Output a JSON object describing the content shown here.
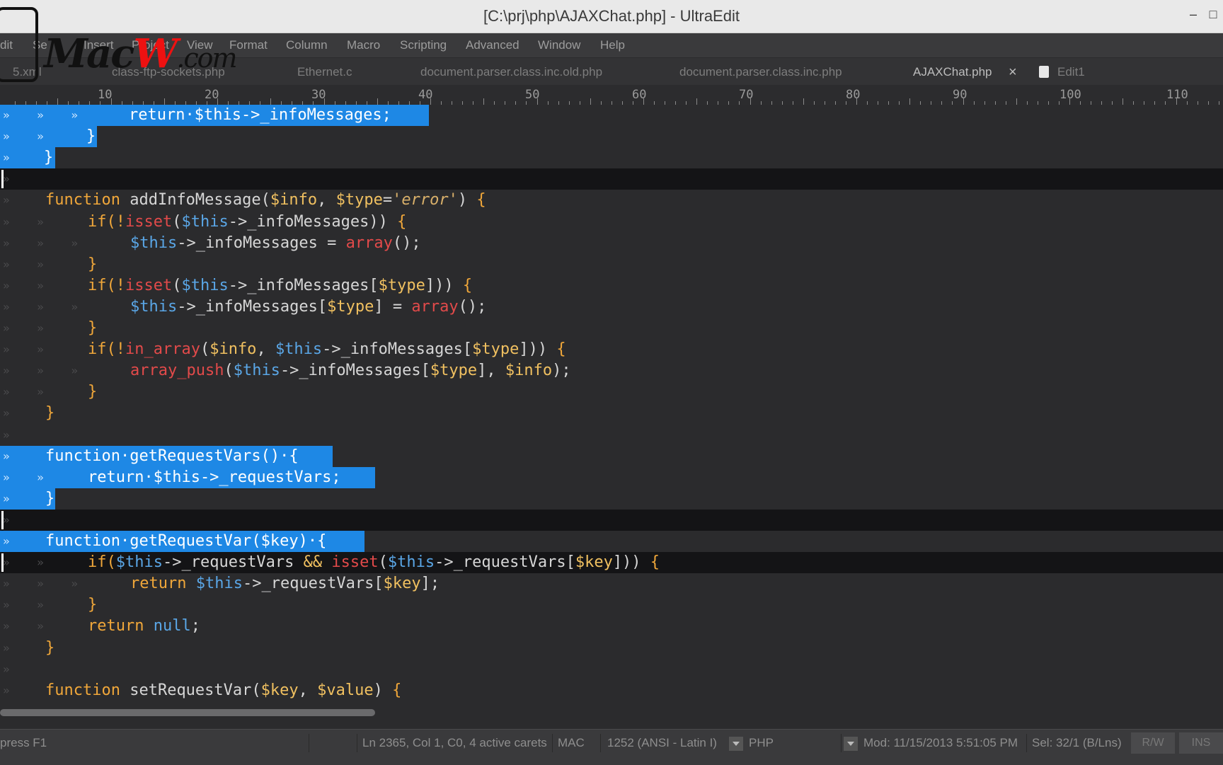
{
  "window": {
    "title": "[C:\\prj\\php\\AJAXChat.php] - UltraEdit",
    "minimize_label": "–",
    "maximize_label": "□"
  },
  "logo": {
    "main": "Mac",
    "accent": "W",
    "suffix": ".com"
  },
  "menu": [
    "dit",
    "Se",
    "Insert",
    "Project",
    "View",
    "Format",
    "Column",
    "Macro",
    "Scripting",
    "Advanced",
    "Window",
    "Help"
  ],
  "tabs": [
    {
      "label": "5.xml",
      "active": false
    },
    {
      "label": "class-ftp-sockets.php",
      "active": false
    },
    {
      "label": "Ethernet.c",
      "active": false
    },
    {
      "label": "document.parser.class.inc.old.php",
      "active": false
    },
    {
      "label": "document.parser.class.inc.php",
      "active": false
    },
    {
      "label": "AJAXChat.php",
      "active": true
    },
    {
      "label": "Edit1",
      "active": false
    }
  ],
  "tab_close": "×",
  "ruler": [
    "10",
    "20",
    "30",
    "40",
    "50",
    "60",
    "70",
    "80",
    "90",
    "100",
    "110"
  ],
  "code": [
    {
      "ws": "»    »    »",
      "segs": [
        [
          "sel",
          "return·$this->_infoMessages;"
        ]
      ],
      "sel": 606,
      "text_left": 182
    },
    {
      "ws": "»    »",
      "segs": [
        [
          "sel",
          "}"
        ]
      ],
      "sel": 137,
      "text_left": 122
    },
    {
      "ws": "»",
      "segs": [
        [
          "sel",
          "}"
        ]
      ],
      "sel": 78,
      "text_left": 62
    },
    {
      "ws": "»",
      "segs": [],
      "dark": true,
      "caret": true
    },
    {
      "ws": "»",
      "segs": [
        [
          "kw",
          "function"
        ],
        [
          "pl",
          " addInfoMessage("
        ],
        [
          "var",
          "$info"
        ],
        [
          "pl",
          ", "
        ],
        [
          "var",
          "$type"
        ],
        [
          "pl",
          "="
        ],
        [
          "str",
          "'error'"
        ],
        [
          "pl",
          ") "
        ],
        [
          "kw",
          "{"
        ]
      ]
    },
    {
      "ws": "»    »",
      "segs": [
        [
          "kw",
          "if(!"
        ],
        [
          "red",
          "isset"
        ],
        [
          "pl",
          "("
        ],
        [
          "this",
          "$this"
        ],
        [
          "pl",
          "->_infoMessages)) "
        ],
        [
          "kw",
          "{"
        ]
      ],
      "indent": 1
    },
    {
      "ws": "»    »    »",
      "segs": [
        [
          "this",
          "$this"
        ],
        [
          "pl",
          "->_infoMessages = "
        ],
        [
          "red",
          "array"
        ],
        [
          "pl",
          "();"
        ]
      ],
      "indent": 2
    },
    {
      "ws": "»    »",
      "segs": [
        [
          "kw",
          "}"
        ]
      ],
      "indent": 1
    },
    {
      "ws": "»    »",
      "segs": [
        [
          "kw",
          "if(!"
        ],
        [
          "red",
          "isset"
        ],
        [
          "pl",
          "("
        ],
        [
          "this",
          "$this"
        ],
        [
          "pl",
          "->_infoMessages["
        ],
        [
          "var",
          "$type"
        ],
        [
          "pl",
          "])) "
        ],
        [
          "kw",
          "{"
        ]
      ],
      "indent": 1
    },
    {
      "ws": "»    »    »",
      "segs": [
        [
          "this",
          "$this"
        ],
        [
          "pl",
          "->_infoMessages["
        ],
        [
          "var",
          "$type"
        ],
        [
          "pl",
          "] = "
        ],
        [
          "red",
          "array"
        ],
        [
          "pl",
          "();"
        ]
      ],
      "indent": 2
    },
    {
      "ws": "»    »",
      "segs": [
        [
          "kw",
          "}"
        ]
      ],
      "indent": 1
    },
    {
      "ws": "»    »",
      "segs": [
        [
          "kw",
          "if(!"
        ],
        [
          "red",
          "in_array"
        ],
        [
          "pl",
          "("
        ],
        [
          "var",
          "$info"
        ],
        [
          "pl",
          ", "
        ],
        [
          "this",
          "$this"
        ],
        [
          "pl",
          "->_infoMessages["
        ],
        [
          "var",
          "$type"
        ],
        [
          "pl",
          "])) "
        ],
        [
          "kw",
          "{"
        ]
      ],
      "indent": 1
    },
    {
      "ws": "»    »    »",
      "segs": [
        [
          "red",
          "array_push"
        ],
        [
          "pl",
          "("
        ],
        [
          "this",
          "$this"
        ],
        [
          "pl",
          "->_infoMessages["
        ],
        [
          "var",
          "$type"
        ],
        [
          "pl",
          "], "
        ],
        [
          "var",
          "$info"
        ],
        [
          "pl",
          ");"
        ]
      ],
      "indent": 2
    },
    {
      "ws": "»    »",
      "segs": [
        [
          "kw",
          "}"
        ]
      ],
      "indent": 1
    },
    {
      "ws": "»",
      "segs": [
        [
          "kw",
          "}"
        ]
      ]
    },
    {
      "ws": "»",
      "segs": []
    },
    {
      "ws": "»",
      "segs": [
        [
          "sel",
          "function·getRequestVars()·{"
        ]
      ],
      "sel": 470
    },
    {
      "ws": "»    »",
      "segs": [
        [
          "sel",
          "return·$this->_requestVars;"
        ]
      ],
      "sel": 530,
      "indent": 1
    },
    {
      "ws": "»",
      "segs": [
        [
          "sel",
          "}"
        ]
      ],
      "sel": 78
    },
    {
      "ws": "»",
      "segs": [],
      "dark": true,
      "caret": true
    },
    {
      "ws": "»",
      "segs": [
        [
          "sel",
          "function·getRequestVar($key)·{"
        ]
      ],
      "sel": 515
    },
    {
      "ws": "»    »",
      "segs": [
        [
          "kw",
          "if("
        ],
        [
          "this",
          "$this"
        ],
        [
          "pl",
          "->_requestVars "
        ],
        [
          "var",
          "&&"
        ],
        [
          "pl",
          " "
        ],
        [
          "red",
          "isset"
        ],
        [
          "pl",
          "("
        ],
        [
          "this",
          "$this"
        ],
        [
          "pl",
          "->_requestVars["
        ],
        [
          "var",
          "$key"
        ],
        [
          "pl",
          "])) "
        ],
        [
          "kw",
          "{"
        ]
      ],
      "indent": 1,
      "dark": true,
      "caret": true
    },
    {
      "ws": "»    »    »",
      "segs": [
        [
          "kw",
          "return"
        ],
        [
          "pl",
          " "
        ],
        [
          "this",
          "$this"
        ],
        [
          "pl",
          "->_requestVars["
        ],
        [
          "var",
          "$key"
        ],
        [
          "pl",
          "];"
        ]
      ],
      "indent": 2
    },
    {
      "ws": "»    »",
      "segs": [
        [
          "kw",
          "}"
        ]
      ],
      "indent": 1
    },
    {
      "ws": "»    »",
      "segs": [
        [
          "kw",
          "return"
        ],
        [
          "pl",
          " "
        ],
        [
          "this",
          "null"
        ],
        [
          "pl",
          ";"
        ]
      ],
      "indent": 1
    },
    {
      "ws": "»",
      "segs": [
        [
          "kw",
          "}"
        ]
      ]
    },
    {
      "ws": "»",
      "segs": []
    },
    {
      "ws": "»",
      "segs": [
        [
          "kw",
          "function"
        ],
        [
          "pl",
          " setRequestVar("
        ],
        [
          "var",
          "$key"
        ],
        [
          "pl",
          ", "
        ],
        [
          "var",
          "$value"
        ],
        [
          "pl",
          ") "
        ],
        [
          "kw",
          "{"
        ]
      ]
    }
  ],
  "status": {
    "help": "press F1",
    "position": "Ln 2365, Col 1, C0, 4 active carets",
    "line_ending": "MAC",
    "encoding": "1252  (ANSI - Latin I)",
    "language": "PHP",
    "modified": "Mod: 11/15/2013 5:51:05 PM",
    "selection": "Sel: 32/1 (B/Lns)",
    "rw": "R/W",
    "ins": "INS"
  }
}
